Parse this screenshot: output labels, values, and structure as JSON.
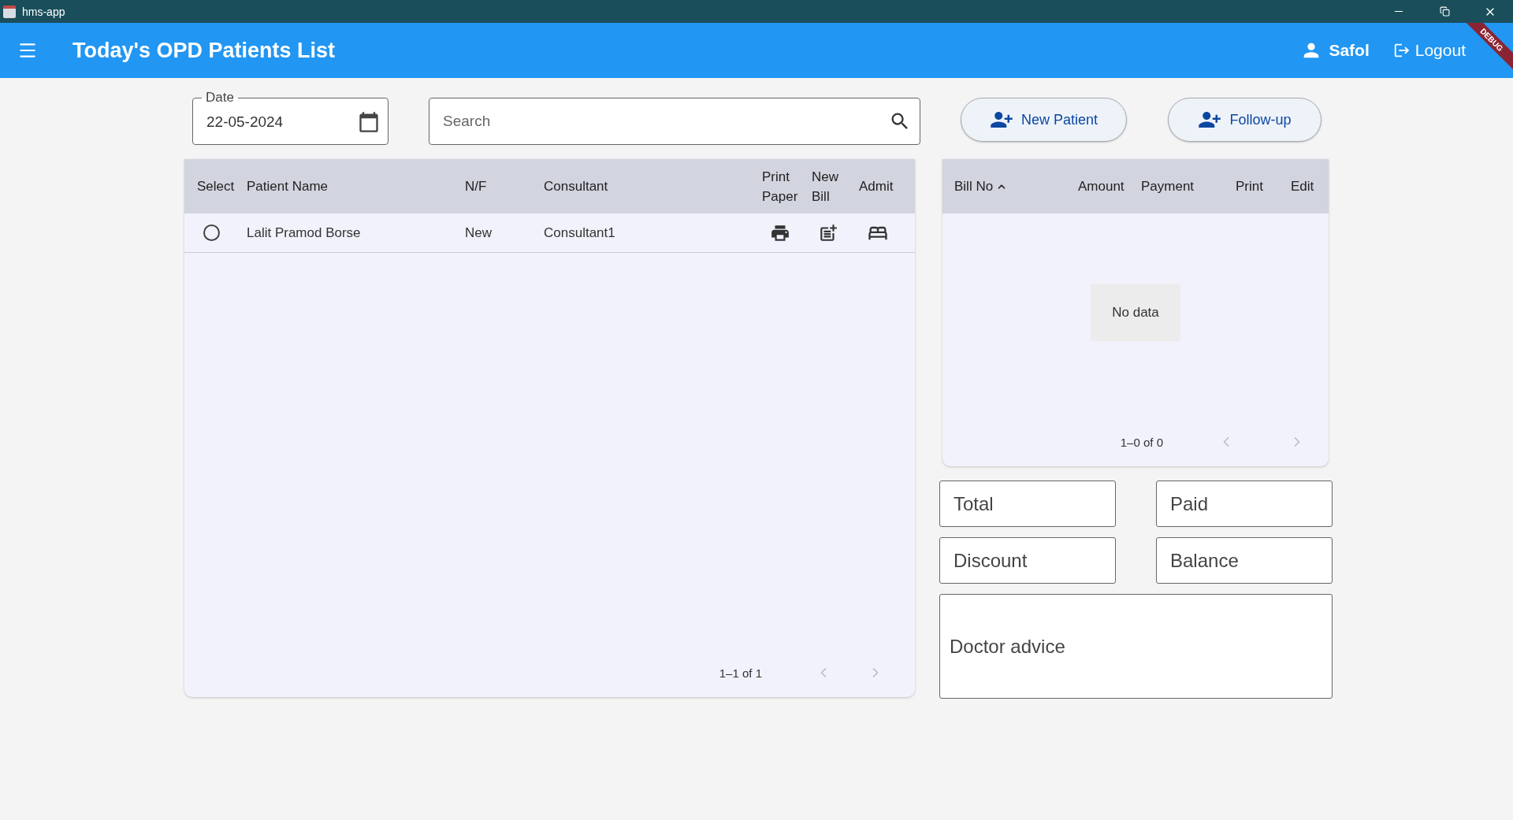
{
  "window": {
    "title": "hms-app"
  },
  "app_bar": {
    "title": "Today's OPD Patients List",
    "user": "Safol",
    "logout": "Logout",
    "banner": "DEBUG"
  },
  "date_field": {
    "label": "Date",
    "value": "22-05-2024"
  },
  "search": {
    "placeholder": "Search"
  },
  "actions": [
    "New Patient",
    "Follow-up"
  ],
  "patients": {
    "columns": [
      "Select",
      "Patient Name",
      "N/F",
      "Consultant",
      "Print Paper",
      "New Bill",
      "Admit"
    ],
    "rows": [
      {
        "selected": false,
        "name": "Lalit Pramod Borse",
        "nf": "New",
        "consultant": "Consultant1"
      }
    ],
    "pagination": "1–1 of 1"
  },
  "bills": {
    "columns": [
      {
        "label": "Bill No",
        "sorted_ascending": true
      },
      {
        "label": "Amount"
      },
      {
        "label": "Payment"
      },
      {
        "label": "Print"
      },
      {
        "label": "Edit"
      }
    ],
    "empty_text": "No data",
    "pagination": "1–0 of 0"
  },
  "summary_fields": [
    {
      "placeholder": "Total"
    },
    {
      "placeholder": "Paid"
    },
    {
      "placeholder": "Discount"
    },
    {
      "placeholder": "Balance"
    }
  ],
  "advice": {
    "placeholder": "Doctor advice"
  }
}
